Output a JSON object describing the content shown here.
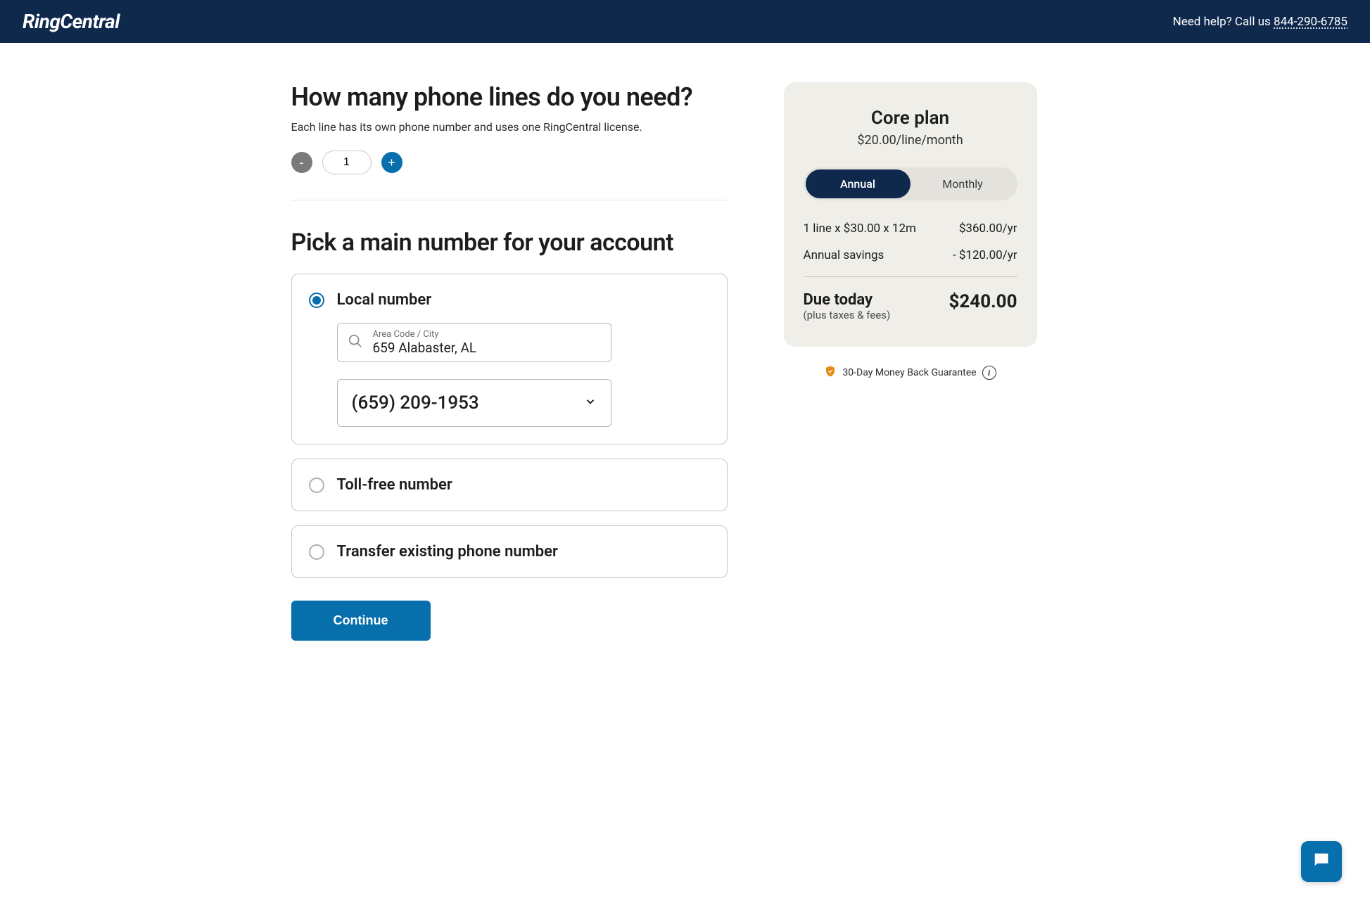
{
  "header": {
    "brand": "RingCentral",
    "help_text": "Need help? Call us ",
    "help_phone": "844-290-6785"
  },
  "lines": {
    "heading": "How many phone lines do you need?",
    "sub": "Each line has its own phone number and uses one RingCentral license.",
    "minus": "-",
    "plus": "+",
    "count": "1"
  },
  "number": {
    "heading": "Pick a main number for your account",
    "options": {
      "local": "Local number",
      "tollfree": "Toll-free number",
      "transfer": "Transfer existing phone number"
    },
    "search": {
      "label": "Area Code / City",
      "value": "659 Alabaster, AL"
    },
    "selected_number": "(659) 209-1953"
  },
  "continue": "Continue",
  "summary": {
    "plan_title": "Core plan",
    "plan_price": "$20.00/line/month",
    "billing": {
      "annual": "Annual",
      "monthly": "Monthly"
    },
    "line_item_label": "1 line x $30.00 x 12m",
    "line_item_value": "$360.00/yr",
    "savings_label": "Annual savings",
    "savings_value": "- $120.00/yr",
    "due_label": "Due today",
    "due_sub": "(plus taxes & fees)",
    "due_amount": "$240.00"
  },
  "guarantee": "30-Day Money Back Guarantee"
}
